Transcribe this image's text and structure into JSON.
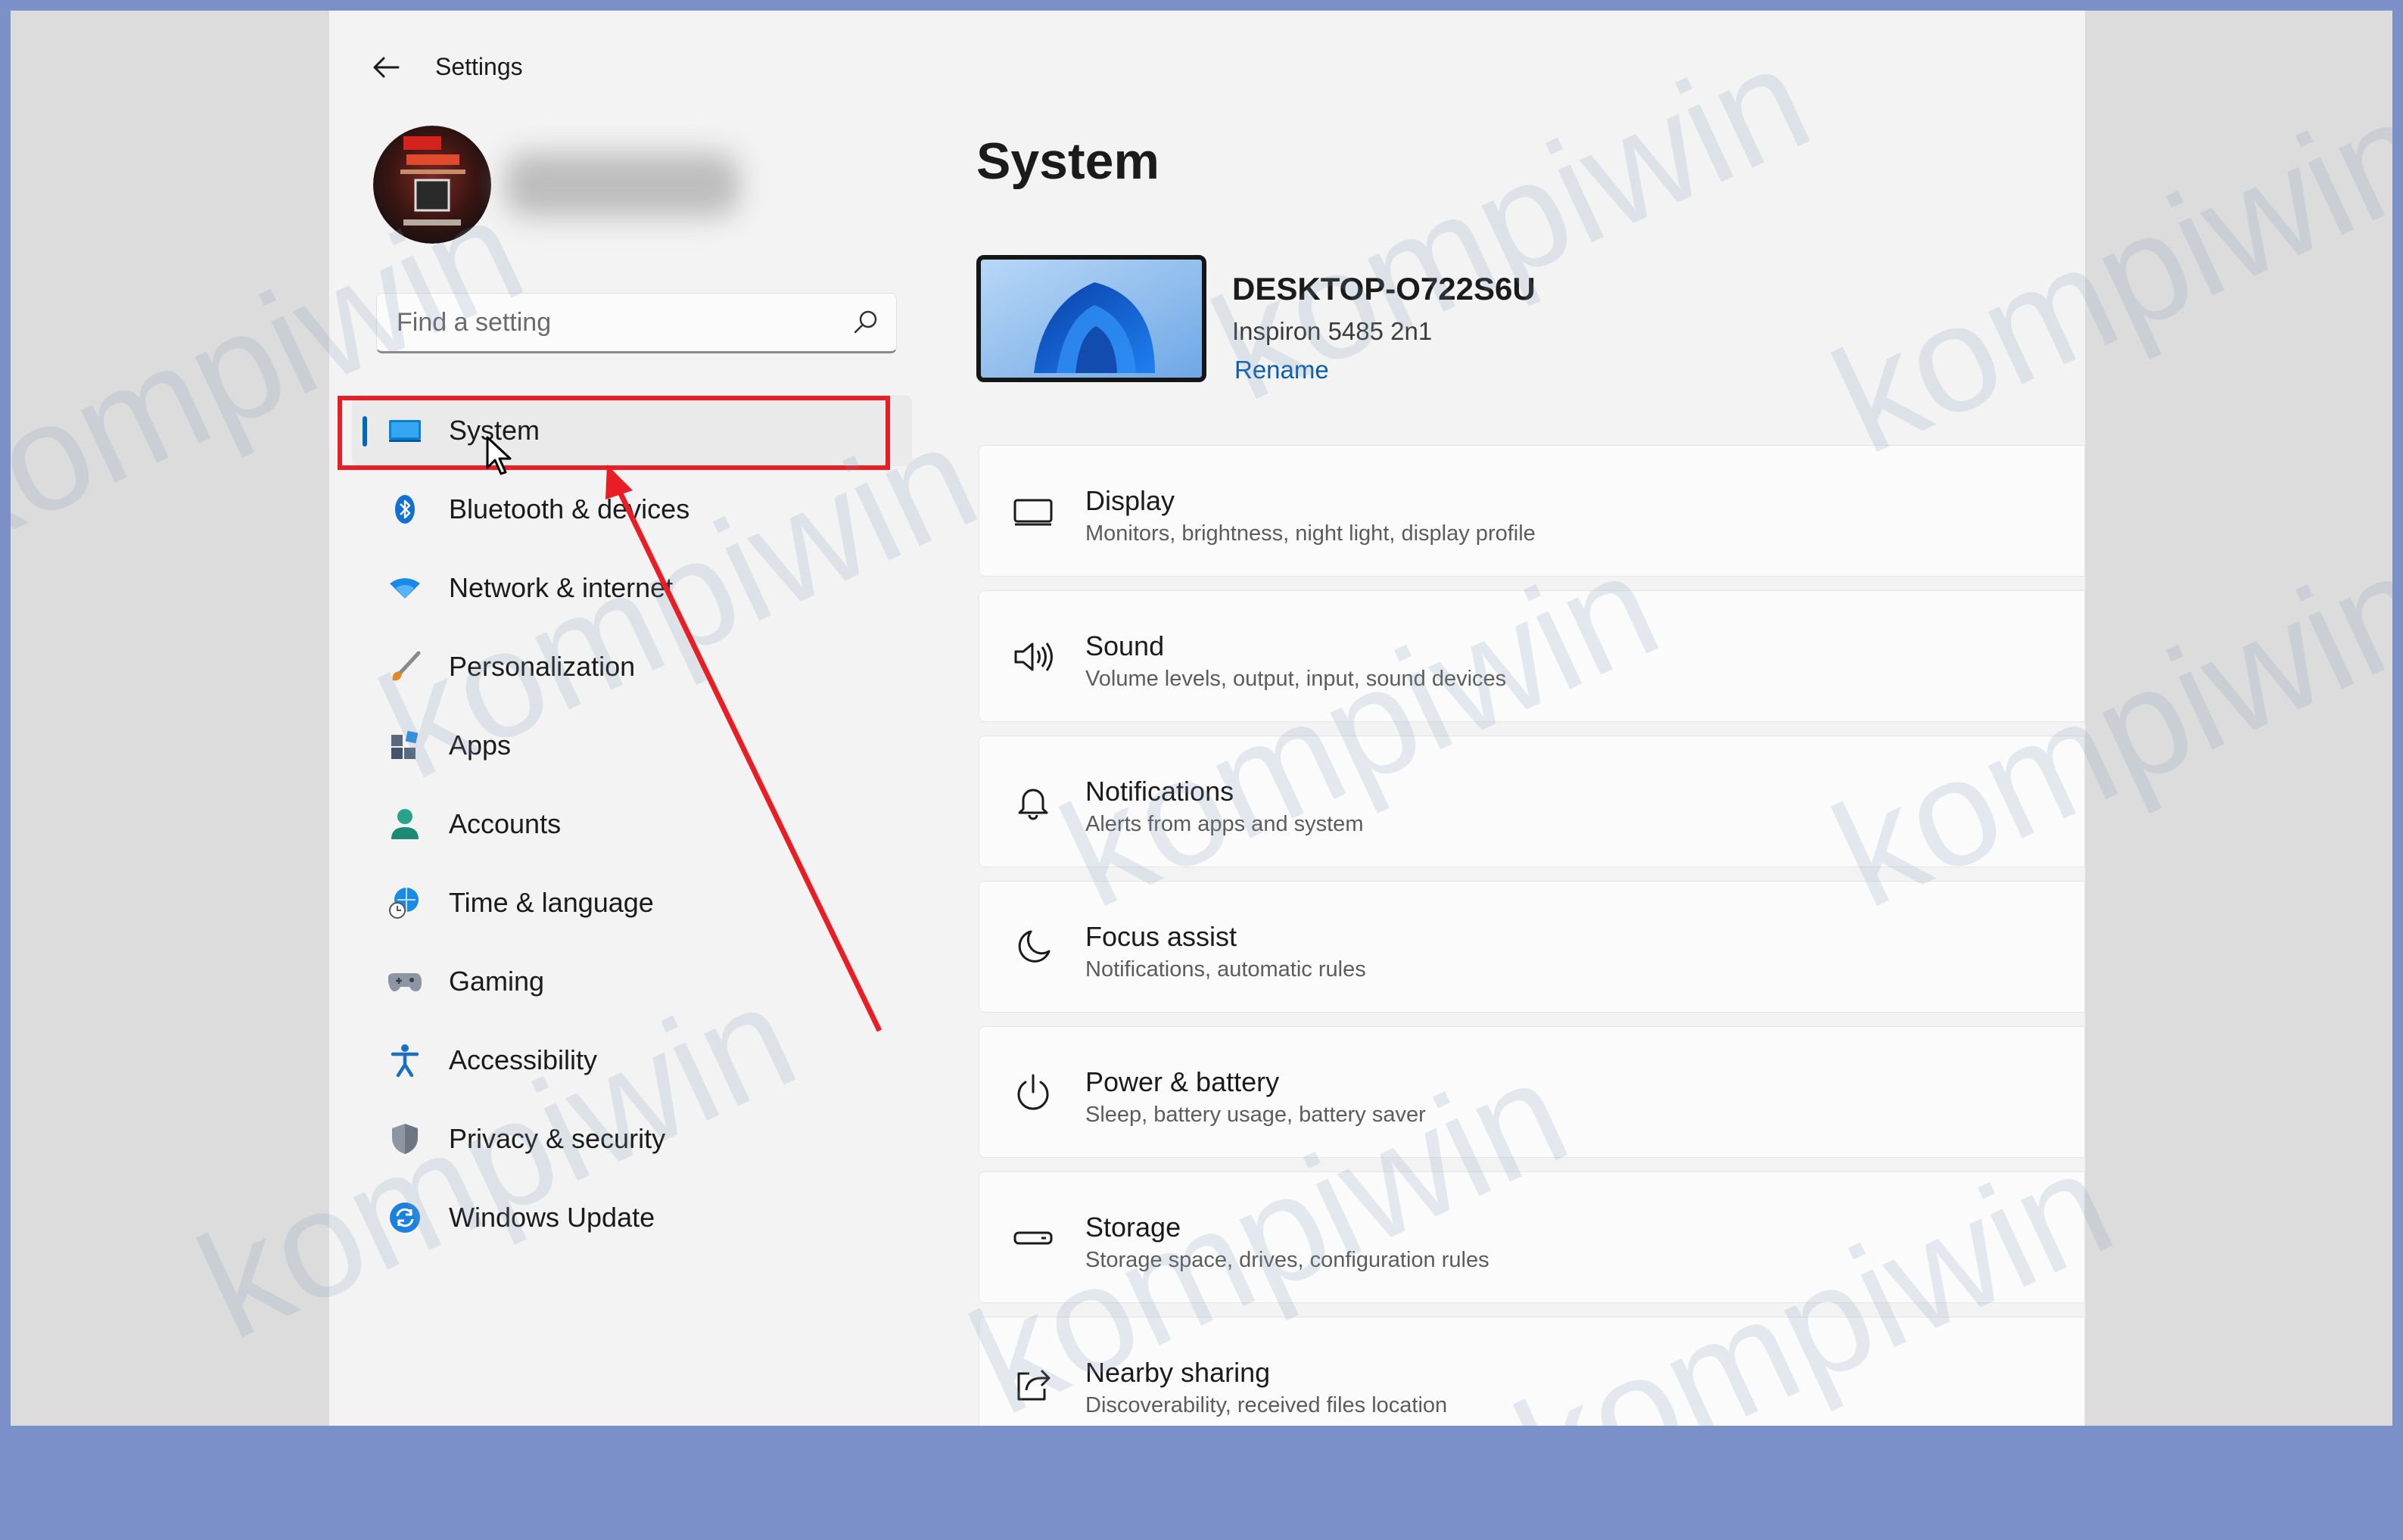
{
  "window": {
    "title": "Settings"
  },
  "search": {
    "placeholder": "Find a setting"
  },
  "nav": {
    "items": [
      {
        "label": "System",
        "icon": "system-icon"
      },
      {
        "label": "Bluetooth & devices",
        "icon": "bluetooth-icon"
      },
      {
        "label": "Network & internet",
        "icon": "wifi-icon"
      },
      {
        "label": "Personalization",
        "icon": "brush-icon"
      },
      {
        "label": "Apps",
        "icon": "apps-icon"
      },
      {
        "label": "Accounts",
        "icon": "person-icon"
      },
      {
        "label": "Time & language",
        "icon": "globe-clock-icon"
      },
      {
        "label": "Gaming",
        "icon": "gamepad-icon"
      },
      {
        "label": "Accessibility",
        "icon": "accessibility-icon"
      },
      {
        "label": "Privacy & security",
        "icon": "shield-icon"
      },
      {
        "label": "Windows Update",
        "icon": "update-icon"
      }
    ],
    "selected": "System"
  },
  "main": {
    "title": "System",
    "device": {
      "name": "DESKTOP-O722S6U",
      "model": "Inspiron 5485 2n1",
      "rename": "Rename"
    },
    "cards": [
      {
        "title": "Display",
        "subtitle": "Monitors, brightness, night light, display profile",
        "icon": "monitor-icon"
      },
      {
        "title": "Sound",
        "subtitle": "Volume levels, output, input, sound devices",
        "icon": "speaker-icon"
      },
      {
        "title": "Notifications",
        "subtitle": "Alerts from apps and system",
        "icon": "bell-icon"
      },
      {
        "title": "Focus assist",
        "subtitle": "Notifications, automatic rules",
        "icon": "moon-icon"
      },
      {
        "title": "Power & battery",
        "subtitle": "Sleep, battery usage, battery saver",
        "icon": "power-icon"
      },
      {
        "title": "Storage",
        "subtitle": "Storage space, drives, configuration rules",
        "icon": "storage-icon"
      },
      {
        "title": "Nearby sharing",
        "subtitle": "Discoverability, received files location",
        "icon": "share-icon"
      }
    ]
  },
  "watermark": "kompiwin",
  "colors": {
    "accent": "#0067c0",
    "highlight": "#ea1c24",
    "frame": "#7b8fc9"
  }
}
